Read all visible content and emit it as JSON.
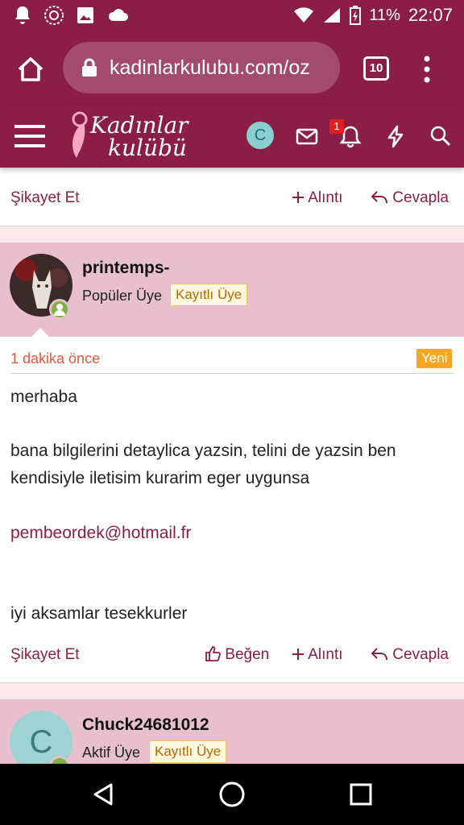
{
  "status": {
    "battery": "11%",
    "time": "22:07"
  },
  "browser": {
    "url": "kadinlarkulubu.com/oz",
    "tab_count": "10"
  },
  "site": {
    "logo_line1": "Kadınlar",
    "logo_line2": "kulübü",
    "user_initial": "C",
    "notification_count": "1"
  },
  "prev_post": {
    "report": "Şikayet Et",
    "quote": "Alıntı",
    "reply": "Cevapla"
  },
  "post": {
    "username": "printemps-",
    "role": "Popüler Üye",
    "tag": "Kayıtlı Üye",
    "time": "1 dakika önce",
    "new_badge": "Yeni",
    "line1": "merhaba",
    "line2": "bana bilgilerini detaylica yazsin, telini de yazsin ben",
    "line3": "kendisiyle iletisim kurarim eger uygunsa",
    "email": "pembeordek@hotmail.fr",
    "line4": "iyi aksamlar tesekkurler",
    "report": "Şikayet Et",
    "like": "Beğen",
    "quote": "Alıntı",
    "reply": "Cevapla"
  },
  "next_post": {
    "username": "Chuck24681012",
    "role": "Aktif Üye",
    "tag": "Kayıtlı Üye",
    "avatar_initial": "C"
  },
  "colors": {
    "primary": "#8b1e45",
    "header_bg": "#e8bfcc",
    "new_badge": "#f5a623",
    "online": "#7cb342"
  }
}
